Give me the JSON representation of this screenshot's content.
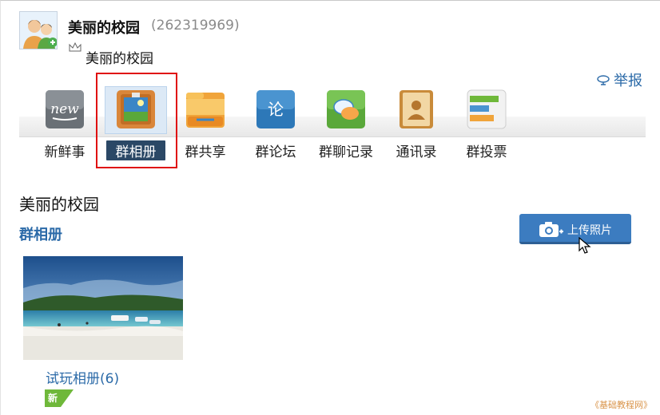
{
  "header": {
    "group_name": "美丽的校园",
    "group_id": "(262319969)",
    "sub_name": "美丽的校园",
    "avatar_icon": "group-avatar-icon",
    "crown_icon": "crown-icon"
  },
  "report": {
    "label": "举报",
    "icon": "report-icon"
  },
  "toolbar": {
    "items": [
      {
        "label": "新鲜事",
        "icon": "news-icon"
      },
      {
        "label": "群相册",
        "icon": "album-icon",
        "selected": true
      },
      {
        "label": "群共享",
        "icon": "folder-icon"
      },
      {
        "label": "群论坛",
        "icon": "forum-icon"
      },
      {
        "label": "群聊记录",
        "icon": "chat-log-icon"
      },
      {
        "label": "通讯录",
        "icon": "contacts-icon"
      },
      {
        "label": "群投票",
        "icon": "vote-icon"
      }
    ]
  },
  "section": {
    "title": "美丽的校园",
    "subtitle": "群相册"
  },
  "upload": {
    "label": "上传照片",
    "icon": "camera-icon"
  },
  "album": {
    "name": "试玩相册(6)",
    "badge": "新",
    "thumb": "beach-photo"
  },
  "watermark": "《基础教程网》",
  "colors": {
    "accent": "#2b6aa8",
    "upload_button": "#3c7cc0",
    "highlight_box": "#e01010",
    "badge": "#6fb83a"
  }
}
